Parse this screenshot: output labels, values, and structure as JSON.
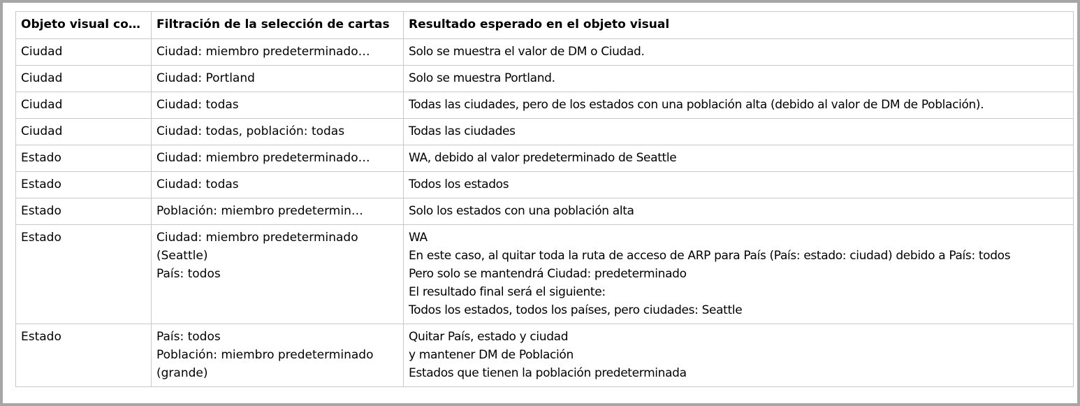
{
  "table": {
    "headers": [
      "Objeto visual con…",
      "Filtración de la selección de cartas",
      "Resultado esperado en el objeto visual"
    ],
    "rows": [
      {
        "c1": "Ciudad",
        "c2": "Ciudad: miembro predeterminado…",
        "c3": "Solo se muestra el valor de DM o Ciudad."
      },
      {
        "c1": "Ciudad",
        "c2": "Ciudad: Portland",
        "c3": "Solo se muestra Portland."
      },
      {
        "c1": "Ciudad",
        "c2": "Ciudad: todas",
        "c3": "Todas las ciudades, pero de los estados con una población alta (debido al valor de DM de Población)."
      },
      {
        "c1": "Ciudad",
        "c2": "Ciudad: todas, población: todas",
        "c3": "Todas las ciudades"
      },
      {
        "c1": "Estado",
        "c2": "Ciudad: miembro predeterminado…",
        "c3": "WA, debido al valor predeterminado de Seattle"
      },
      {
        "c1": "Estado",
        "c2": "Ciudad: todas",
        "c3": "Todos los estados"
      },
      {
        "c1": "Estado",
        "c2": "Población: miembro predetermin…",
        "c3": "Solo los estados con una población alta"
      },
      {
        "c1": "Estado",
        "c2_lines": [
          "Ciudad: miembro predeterminado",
          "(Seattle)",
          "País: todos"
        ],
        "c3_lines": [
          "WA",
          "En este caso, al quitar toda la ruta de acceso de ARP para País (País: estado: ciudad) debido a País: todos",
          "Pero solo se mantendrá Ciudad: predeterminado",
          "El resultado final será el siguiente:",
          "Todos los estados, todos los países, pero ciudades: Seattle"
        ]
      },
      {
        "c1": "Estado",
        "c2_lines": [
          "País: todos",
          "Población: miembro predeterminado",
          "(grande)"
        ],
        "c3_lines": [
          "Quitar País, estado y ciudad",
          "y mantener DM de Población",
          "Estados que tienen la población predeterminada"
        ]
      }
    ]
  }
}
